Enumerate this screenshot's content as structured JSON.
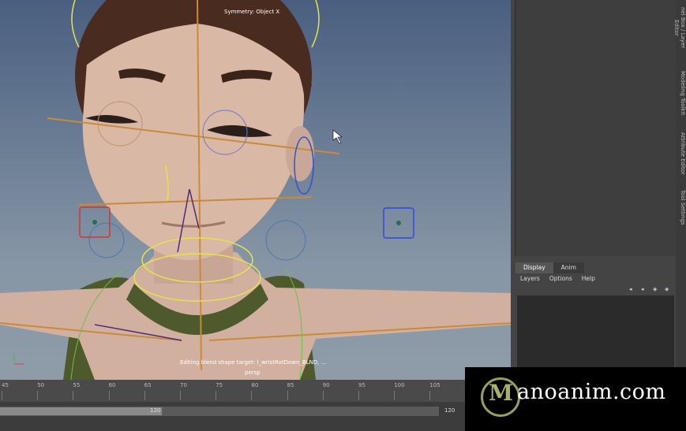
{
  "viewport": {
    "symmetry_label": "Symmetry: Object X",
    "status_line": "Editing blend shape target: l_wristRotDown_BLND, ...",
    "camera_label": "persp"
  },
  "side_tabs": [
    "nel Box / Layer Editor",
    "Modeling Toolkit",
    "Attribute Editor",
    "Tool Settings"
  ],
  "layer_editor": {
    "tabs": [
      "Display",
      "Anim"
    ],
    "menu": [
      "Layers",
      "Options",
      "Help"
    ]
  },
  "timeline": {
    "ticks": [
      "45",
      "50",
      "55",
      "60",
      "65",
      "70",
      "75",
      "80",
      "85",
      "90",
      "95",
      "100",
      "105"
    ],
    "range_end": "120",
    "range_total": "120"
  },
  "watermark": {
    "text": "anoanim.com",
    "mark": "M"
  },
  "colors": {
    "viewport_top": "#4a5f80",
    "viewport_bottom": "#8f9ca8",
    "skin": "#d6b5a3",
    "hair": "#4a2b1f",
    "shirt": "#4f5a2c",
    "rig_orange": "#c98a3a",
    "rig_yellow": "#e6e34a"
  }
}
